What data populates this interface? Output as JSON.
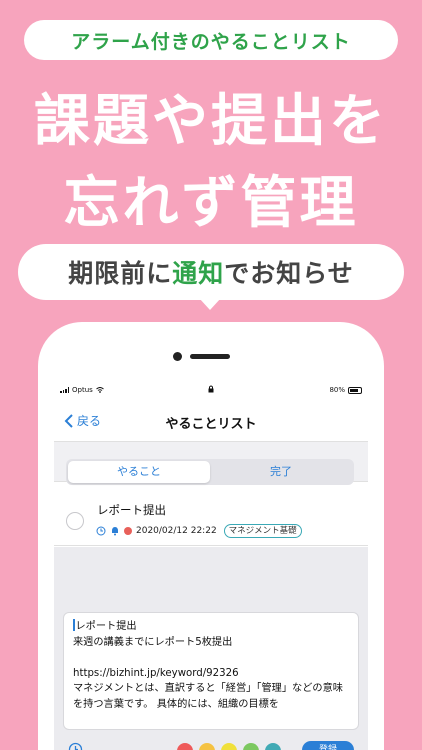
{
  "promo": {
    "top_pill": "アラーム付きのやることリスト",
    "headline_line1": "課題や提出を",
    "headline_line2": "忘れず管理",
    "bubble_pre": "期限前に",
    "bubble_accent": "通知",
    "bubble_post": "でお知らせ",
    "accent_color": "#2fa34a",
    "background_color": "#f7a4bd"
  },
  "status_bar": {
    "carrier": "Optus",
    "battery": "80%"
  },
  "nav": {
    "back_label": "戻る",
    "title": "やることリスト"
  },
  "segments": [
    {
      "label": "やること",
      "selected": true
    },
    {
      "label": "完了",
      "selected": false
    }
  ],
  "task": {
    "title": "レポート提出",
    "due": "2020/02/12 22:22",
    "tag": "マネジメント基礎",
    "has_alarm": true,
    "priority_color": "#e8605a"
  },
  "detail": {
    "line1": "レポート提出",
    "line2": "来週の講義までにレポート5枚提出",
    "line3": "",
    "line4": "https://bizhint.jp/keyword/92326",
    "line5": "マネジメントとは、直訳すると「経営」「管理」などの意味を持つ言葉です。 具体的には、組織の目標を"
  },
  "toolbar": {
    "colors": [
      "#ef5a5a",
      "#f5c242",
      "#f0e03a",
      "#7cc860",
      "#41aab5"
    ],
    "save_label": "登録"
  }
}
